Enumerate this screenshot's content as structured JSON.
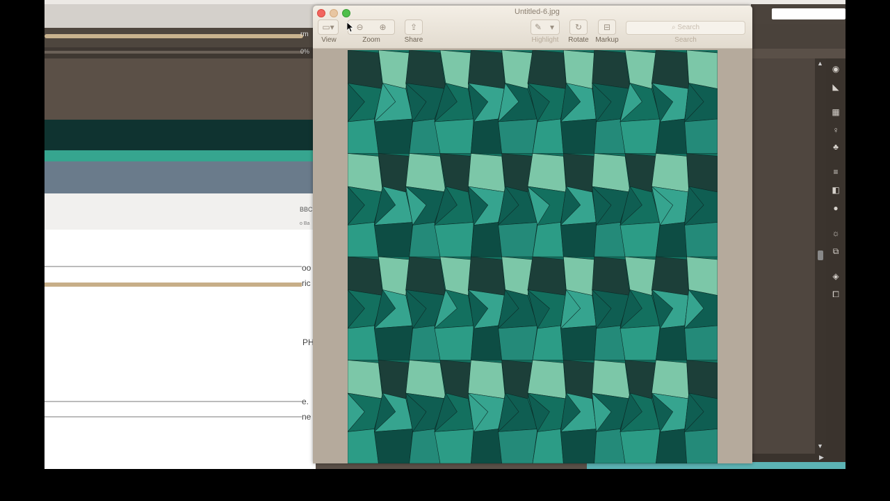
{
  "background_app": {
    "fragments": [
      "rm",
      "0%",
      "BBC",
      "o Ba",
      "oo",
      "ric",
      "PH",
      "e.",
      "ne"
    ]
  },
  "preview": {
    "title": "Untitled-6.jpg",
    "toolbar": {
      "view_label": "View",
      "zoom_label": "Zoom",
      "share_label": "Share",
      "highlight_label": "Highlight",
      "rotate_label": "Rotate",
      "markup_label": "Markup",
      "search_label": "Search",
      "search_placeholder": "Search"
    },
    "icons": {
      "view": "sidebar-view-icon",
      "zoom_out": "zoom-out-icon",
      "zoom_in": "zoom-in-icon",
      "share": "share-icon",
      "highlight": "highlighter-pen-icon",
      "rotate": "rotate-icon",
      "markup": "toolbox-icon",
      "search": "magnifier-icon"
    }
  },
  "pattern": {
    "rows": 4,
    "colors": [
      "#1c3f39",
      "#7cc7a8",
      "#13705f",
      "#36a48f",
      "#0f5e52",
      "#248a79",
      "#2c9c86",
      "#0d4d44"
    ]
  }
}
